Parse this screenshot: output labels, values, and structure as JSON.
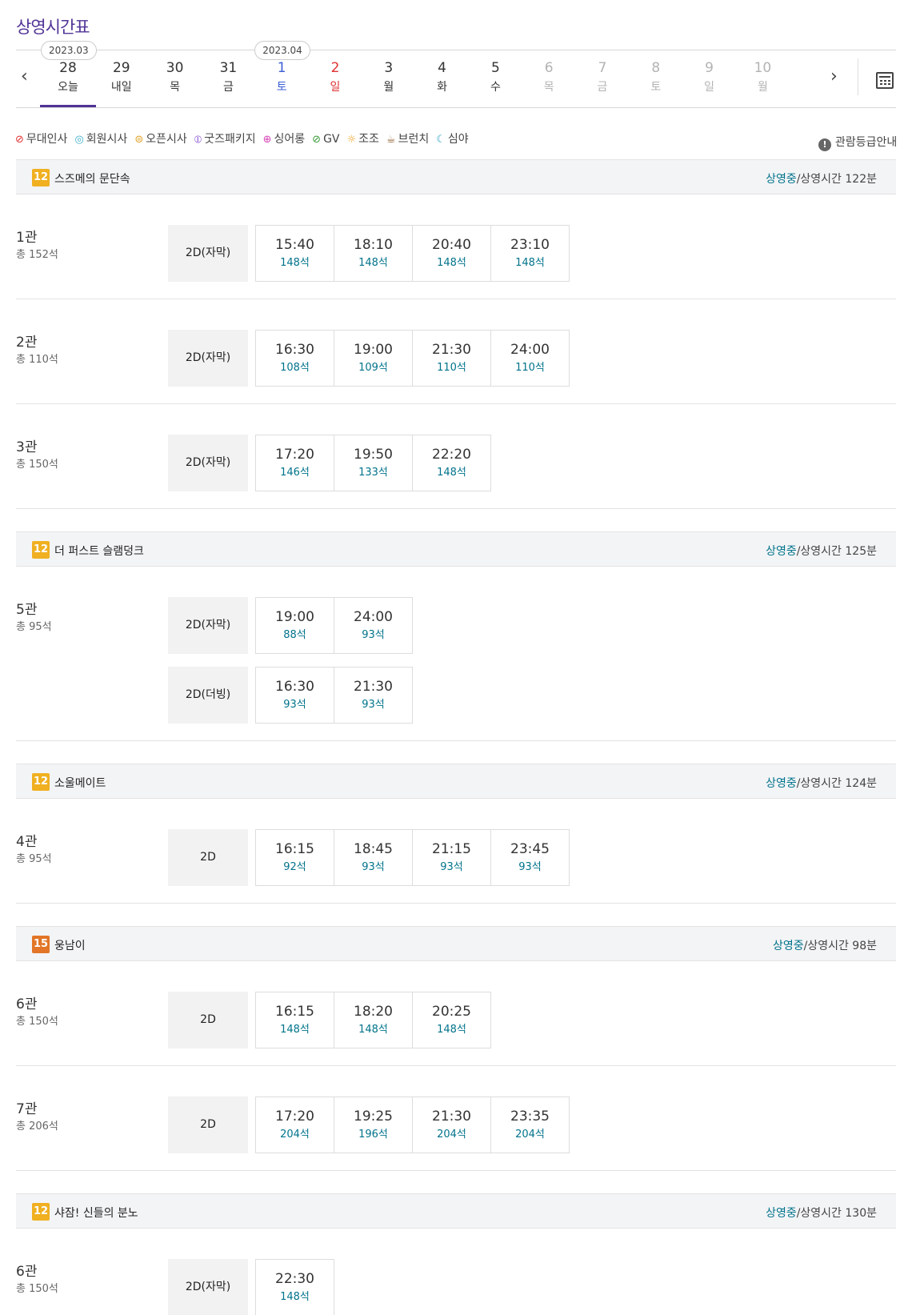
{
  "page_title": "상영시간표",
  "date_bar": {
    "month_tags": [
      "2023.03",
      "2023.04"
    ],
    "days": [
      {
        "num": "28",
        "wd": "오늘",
        "kind": "active"
      },
      {
        "num": "29",
        "wd": "내일",
        "kind": ""
      },
      {
        "num": "30",
        "wd": "목",
        "kind": ""
      },
      {
        "num": "31",
        "wd": "금",
        "kind": ""
      },
      {
        "num": "1",
        "wd": "토",
        "kind": "sat"
      },
      {
        "num": "2",
        "wd": "일",
        "kind": "sun"
      },
      {
        "num": "3",
        "wd": "월",
        "kind": ""
      },
      {
        "num": "4",
        "wd": "화",
        "kind": ""
      },
      {
        "num": "5",
        "wd": "수",
        "kind": ""
      },
      {
        "num": "6",
        "wd": "목",
        "kind": "dis"
      },
      {
        "num": "7",
        "wd": "금",
        "kind": "dis"
      },
      {
        "num": "8",
        "wd": "토",
        "kind": "dis"
      },
      {
        "num": "9",
        "wd": "일",
        "kind": "dis"
      },
      {
        "num": "10",
        "wd": "월",
        "kind": "dis"
      }
    ],
    "prev_icon": "chevron-left-icon",
    "next_icon": "chevron-right-icon",
    "calendar_icon": "calendar-icon"
  },
  "legend": [
    {
      "label": "무대인사",
      "icon": "stage-greeting-icon",
      "color": "#e03131",
      "glyph": "⊘"
    },
    {
      "label": "회원시사",
      "icon": "member-preview-icon",
      "color": "#3bb0c9",
      "glyph": "◎"
    },
    {
      "label": "오픈시사",
      "icon": "open-preview-icon",
      "color": "#e0a020",
      "glyph": "⊜"
    },
    {
      "label": "굿즈패키지",
      "icon": "goods-package-icon",
      "color": "#7b3fd1",
      "glyph": "⦶"
    },
    {
      "label": "싱어롱",
      "icon": "singalong-icon",
      "color": "#d63fb3",
      "glyph": "⊕"
    },
    {
      "label": "GV",
      "icon": "gv-icon",
      "color": "#3a9a3a",
      "glyph": "⊘"
    },
    {
      "label": "조조",
      "icon": "sun-icon",
      "color": "#f0a020",
      "glyph": "☼"
    },
    {
      "label": "브런치",
      "icon": "coffee-icon",
      "color": "#8a5a2a",
      "glyph": "☕"
    },
    {
      "label": "심야",
      "icon": "moon-icon",
      "color": "#2aa0c8",
      "glyph": "☾"
    }
  ],
  "rating_guide": "관람등급안내",
  "status_label": "상영중",
  "movies": [
    {
      "rating": "12",
      "rating_color": "#f0b021",
      "title": "스즈메의 문단속",
      "runtime": "/상영시간 122분",
      "halls": [
        {
          "name": "1관",
          "total": "총 152석",
          "formats": [
            {
              "fmt": "2D(자막)",
              "slots": [
                {
                  "t": "15:40",
                  "s": "148석"
                },
                {
                  "t": "18:10",
                  "s": "148석"
                },
                {
                  "t": "20:40",
                  "s": "148석"
                },
                {
                  "t": "23:10",
                  "s": "148석"
                }
              ]
            }
          ]
        },
        {
          "name": "2관",
          "total": "총 110석",
          "formats": [
            {
              "fmt": "2D(자막)",
              "slots": [
                {
                  "t": "16:30",
                  "s": "108석"
                },
                {
                  "t": "19:00",
                  "s": "109석"
                },
                {
                  "t": "21:30",
                  "s": "110석"
                },
                {
                  "t": "24:00",
                  "s": "110석"
                }
              ]
            }
          ]
        },
        {
          "name": "3관",
          "total": "총 150석",
          "formats": [
            {
              "fmt": "2D(자막)",
              "slots": [
                {
                  "t": "17:20",
                  "s": "146석"
                },
                {
                  "t": "19:50",
                  "s": "133석"
                },
                {
                  "t": "22:20",
                  "s": "148석"
                }
              ]
            }
          ]
        }
      ]
    },
    {
      "rating": "12",
      "rating_color": "#f0b021",
      "title": "더 퍼스트 슬램덩크",
      "runtime": "/상영시간 125분",
      "halls": [
        {
          "name": "5관",
          "total": "총 95석",
          "formats": [
            {
              "fmt": "2D(자막)",
              "slots": [
                {
                  "t": "19:00",
                  "s": "88석"
                },
                {
                  "t": "24:00",
                  "s": "93석"
                }
              ]
            },
            {
              "fmt": "2D(더빙)",
              "slots": [
                {
                  "t": "16:30",
                  "s": "93석"
                },
                {
                  "t": "21:30",
                  "s": "93석"
                }
              ]
            }
          ]
        }
      ]
    },
    {
      "rating": "12",
      "rating_color": "#f0b021",
      "title": "소울메이트",
      "runtime": "/상영시간 124분",
      "halls": [
        {
          "name": "4관",
          "total": "총 95석",
          "formats": [
            {
              "fmt": "2D",
              "slots": [
                {
                  "t": "16:15",
                  "s": "92석"
                },
                {
                  "t": "18:45",
                  "s": "93석"
                },
                {
                  "t": "21:15",
                  "s": "93석"
                },
                {
                  "t": "23:45",
                  "s": "93석"
                }
              ]
            }
          ]
        }
      ]
    },
    {
      "rating": "15",
      "rating_color": "#e27527",
      "title": "웅남이",
      "runtime": "/상영시간 98분",
      "halls": [
        {
          "name": "6관",
          "total": "총 150석",
          "formats": [
            {
              "fmt": "2D",
              "slots": [
                {
                  "t": "16:15",
                  "s": "148석"
                },
                {
                  "t": "18:20",
                  "s": "148석"
                },
                {
                  "t": "20:25",
                  "s": "148석"
                }
              ]
            }
          ]
        },
        {
          "name": "7관",
          "total": "총 206석",
          "formats": [
            {
              "fmt": "2D",
              "slots": [
                {
                  "t": "17:20",
                  "s": "204석"
                },
                {
                  "t": "19:25",
                  "s": "196석"
                },
                {
                  "t": "21:30",
                  "s": "204석"
                },
                {
                  "t": "23:35",
                  "s": "204석"
                }
              ]
            }
          ]
        }
      ]
    },
    {
      "rating": "12",
      "rating_color": "#f0b021",
      "title": "샤잠! 신들의 분노",
      "runtime": "/상영시간 130분",
      "halls": [
        {
          "name": "6관",
          "total": "총 150석",
          "formats": [
            {
              "fmt": "2D(자막)",
              "slots": [
                {
                  "t": "22:30",
                  "s": "148석"
                }
              ]
            }
          ]
        }
      ]
    }
  ]
}
